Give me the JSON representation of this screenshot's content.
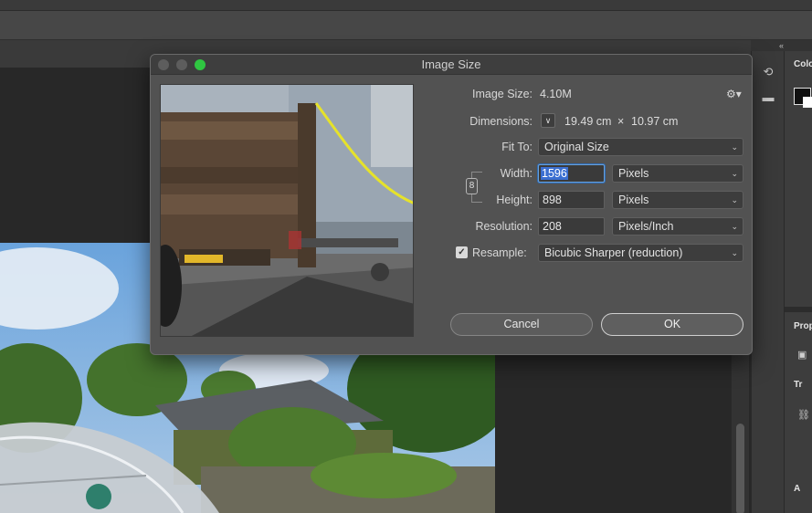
{
  "dialog": {
    "title": "Image Size",
    "image_size_label": "Image Size:",
    "image_size_value": "4.10M",
    "dimensions_label": "Dimensions:",
    "dimensions_width": "19.49 cm",
    "dimensions_separator": "×",
    "dimensions_height": "10.97 cm",
    "fit_to_label": "Fit To:",
    "fit_to_value": "Original Size",
    "width_label": "Width:",
    "width_value": "1596",
    "width_unit": "Pixels",
    "height_label": "Height:",
    "height_value": "898",
    "height_unit": "Pixels",
    "resolution_label": "Resolution:",
    "resolution_value": "208",
    "resolution_unit": "Pixels/Inch",
    "resample_label": "Resample:",
    "resample_checked": true,
    "resample_value": "Bicubic Sharper (reduction)",
    "cancel_label": "Cancel",
    "ok_label": "OK"
  },
  "panels": {
    "color_tab": "Colo",
    "properties_tab": "Prop",
    "transform_tab": "Tr",
    "appearance_tab": "A"
  },
  "icons": {
    "gear": "gear-icon",
    "link": "link-icon",
    "chevron": "chevron-down-icon",
    "collapse": "double-chevron-left-icon"
  },
  "colors": {
    "dialog_bg": "#525252",
    "selection": "#3b6fd1",
    "maximize": "#2fc641"
  }
}
